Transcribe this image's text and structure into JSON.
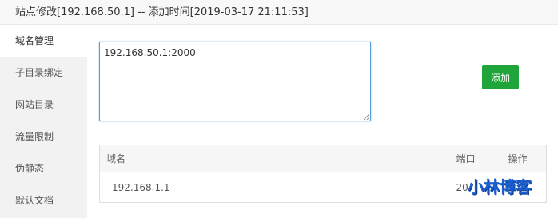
{
  "dialog": {
    "title": "站点修改[192.168.50.1] -- 添加时间[2019-03-17 21:11:53]"
  },
  "sidebar": {
    "items": [
      {
        "label": "域名管理",
        "active": true
      },
      {
        "label": "子目录绑定",
        "active": false
      },
      {
        "label": "网站目录",
        "active": false
      },
      {
        "label": "流量限制",
        "active": false
      },
      {
        "label": "伪静态",
        "active": false
      },
      {
        "label": "默认文档",
        "active": false
      }
    ]
  },
  "domain_form": {
    "textarea_value": "192.168.50.1:2000",
    "add_button_label": "添加"
  },
  "domain_table": {
    "headers": {
      "domain": "域名",
      "port": "端口",
      "action": "操作"
    },
    "rows": [
      {
        "domain": "192.168.1.1",
        "port": "20"
      }
    ]
  },
  "watermark": {
    "text": "小林博客"
  },
  "colors": {
    "accent_green": "#20a53a",
    "focus_border": "#5b9bd5",
    "sidebar_bg": "#f2f2f2",
    "watermark_blue": "#1a5fd0"
  }
}
